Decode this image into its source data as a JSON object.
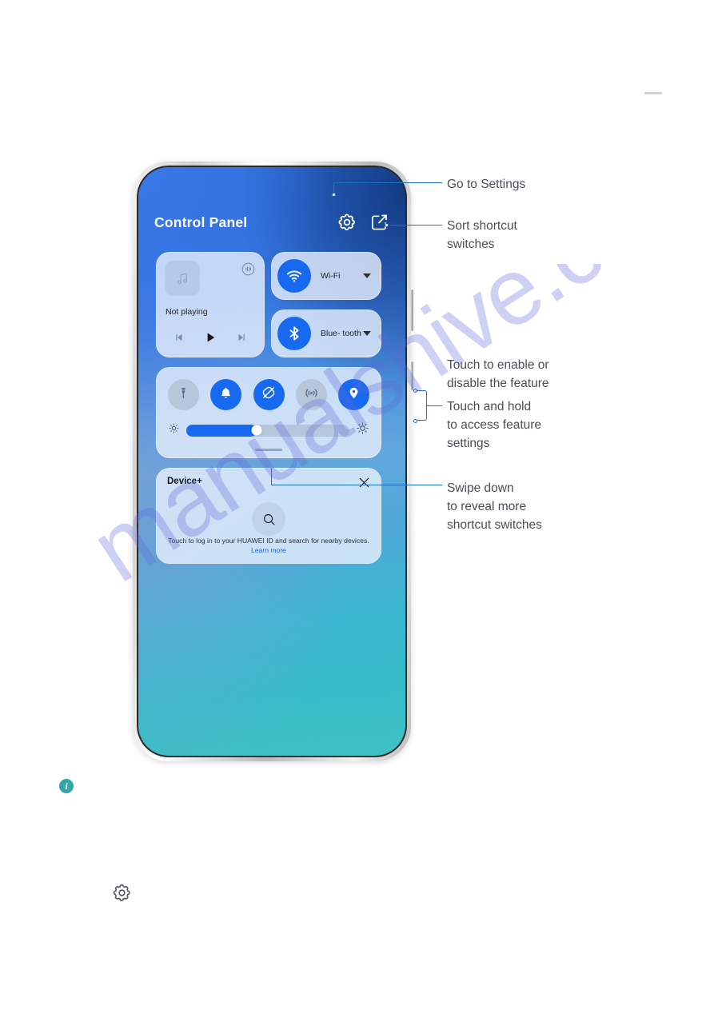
{
  "doc": {
    "watermark": "manualshive.com",
    "info_badge": "i",
    "footer_gear_icon": "gear-icon",
    "top_rule": ""
  },
  "phone": {
    "control_panel": {
      "title": "Control Panel",
      "header_icons": [
        {
          "name": "settings-gear-icon",
          "label": "Go to Settings"
        },
        {
          "name": "edit-sort-icon",
          "label": "Sort shortcut switches"
        }
      ],
      "media_card": {
        "album_art_icon": "music-note-icon",
        "cast_icon": "cast-audio-icon",
        "status": "Not playing",
        "controls": [
          {
            "name": "previous-track-button",
            "icon": "skip-previous-icon"
          },
          {
            "name": "play-button",
            "icon": "play-icon"
          },
          {
            "name": "next-track-button",
            "icon": "skip-next-icon"
          }
        ]
      },
      "tiles": [
        {
          "name": "wifi-tile",
          "label": "Wi-Fi",
          "icon": "wifi-icon",
          "state": "on"
        },
        {
          "name": "bluetooth-tile",
          "label": "Blue-\ntooth",
          "icon": "bluetooth-icon",
          "state": "on"
        }
      ],
      "toggles": [
        {
          "name": "flashlight-toggle",
          "icon": "flashlight-icon",
          "state": "off"
        },
        {
          "name": "ringer-toggle",
          "icon": "bell-icon",
          "state": "on"
        },
        {
          "name": "auto-rotate-toggle",
          "icon": "auto-rotate-icon",
          "state": "on"
        },
        {
          "name": "hotspot-toggle",
          "icon": "hotspot-icon",
          "state": "off"
        },
        {
          "name": "location-toggle",
          "icon": "location-pin-icon",
          "state": "on"
        }
      ],
      "brightness": {
        "low_icon": "brightness-low-icon",
        "high_icon": "brightness-high-icon",
        "value_percent": 43
      },
      "drag_handle": "swipe-down-handle",
      "device_plus": {
        "title": "Device+",
        "close_icon": "close-icon",
        "search_icon": "search-icon",
        "description": "Touch to log in to your HUAWEI ID and search for nearby devices. ",
        "link": "Learn more"
      }
    }
  },
  "annotations": [
    {
      "id": "a1",
      "text": "Go to Settings"
    },
    {
      "id": "a2",
      "text": "Sort shortcut\nswitches"
    },
    {
      "id": "a3",
      "text": "Touch to enable or\ndisable the feature"
    },
    {
      "id": "a4",
      "text": "Touch and hold\nto access feature\nsettings"
    },
    {
      "id": "a5",
      "text": "Swipe down\nto reveal more\nshortcut switches"
    }
  ],
  "colors": {
    "accent_blue": "#1769f0",
    "leader_blue": "#1b72c4",
    "anno_text": "#4a4f55",
    "info_teal": "#34a6a6",
    "toggle_off": "rgba(167,178,196,0.55)"
  }
}
